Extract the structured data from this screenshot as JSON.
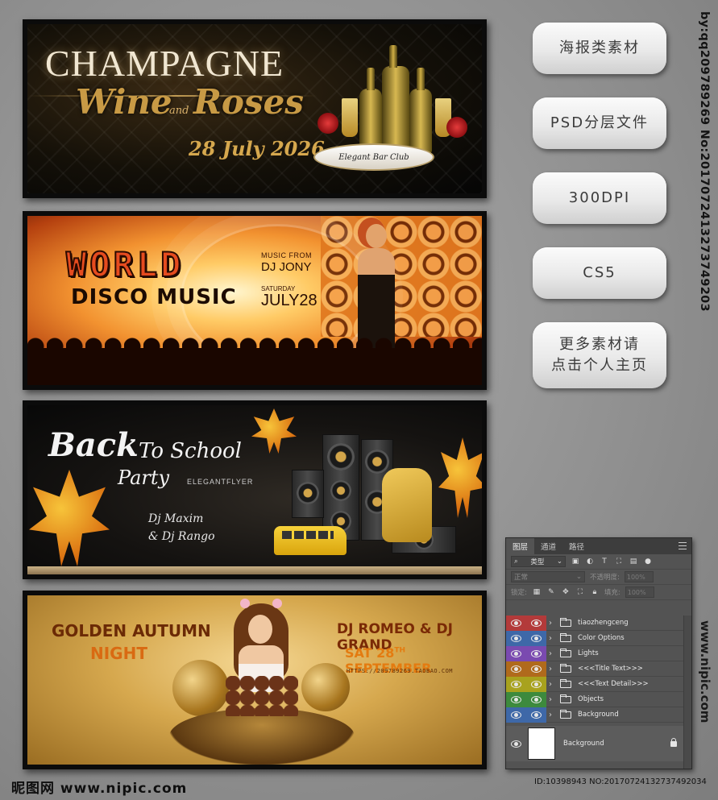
{
  "banners": {
    "champagne": {
      "title": "CHAMPAGNE",
      "subtitle_left": "Wine",
      "and_word": "and",
      "subtitle_right": "Roses",
      "date": "28 July 2026",
      "ribbon_text": "Elegant Bar Club"
    },
    "disco": {
      "title": "WORLD",
      "subtitle": "DISCO MUSIC",
      "music_from": "MUSIC FROM",
      "dj": "DJ JONY",
      "saturday": "SATURDAY",
      "date": "JULY28"
    },
    "school": {
      "title_back": "Back",
      "title_to_school": "To School",
      "title_party": "Party",
      "brand": "ELEGANTFLYER",
      "dj_line1": "Dj Maxim",
      "dj_line2": "& Dj Rango"
    },
    "autumn": {
      "title_line1": "GOLDEN AUTUMN",
      "title_line2": "NIGHT",
      "djs": "DJ ROMEO & DJ GRAND",
      "date_prefix": "SAT 28",
      "date_sup": "TH",
      "date_suffix": " SEPTEMBER",
      "url": "HTTPS://209789269.TAOBAO.COM"
    }
  },
  "side_buttons": [
    {
      "label": "海报类素材"
    },
    {
      "label": "PSD分层文件"
    },
    {
      "label": "300DPI"
    },
    {
      "label": "CS5"
    },
    {
      "label_line1": "更多素材请",
      "label_line2": "点击个人主页"
    }
  ],
  "watermark": {
    "vertical_top": "by:qq209789269 No:20170724132737492034",
    "vertical_bottom": "www.nipic.com",
    "logo": "昵图网 www.nipic.com",
    "footer_id": "ID:10398943 NO:20170724132737492034"
  },
  "layers_panel": {
    "tabs": [
      "图层",
      "通道",
      "路径"
    ],
    "active_tab": "图层",
    "filter_label": "类型",
    "blend_mode": "正常",
    "opacity_label": "不透明度:",
    "opacity_value": "100%",
    "lock_label": "锁定:",
    "fill_label": "填充:",
    "fill_value": "100%",
    "layers": [
      {
        "name": "tiaozhengceng",
        "color": "#b33a3a"
      },
      {
        "name": "Color Options",
        "color": "#3e68a8"
      },
      {
        "name": "Lights",
        "color": "#7a4ab0"
      },
      {
        "name": "<<<Title Text>>>",
        "color": "#b06a1c"
      },
      {
        "name": "<<<Text Detail>>>",
        "color": "#a8a21e"
      },
      {
        "name": "Objects",
        "color": "#3d8a3d"
      },
      {
        "name": "Background",
        "color": "#3e68a8"
      }
    ],
    "background_layer": "Background"
  }
}
